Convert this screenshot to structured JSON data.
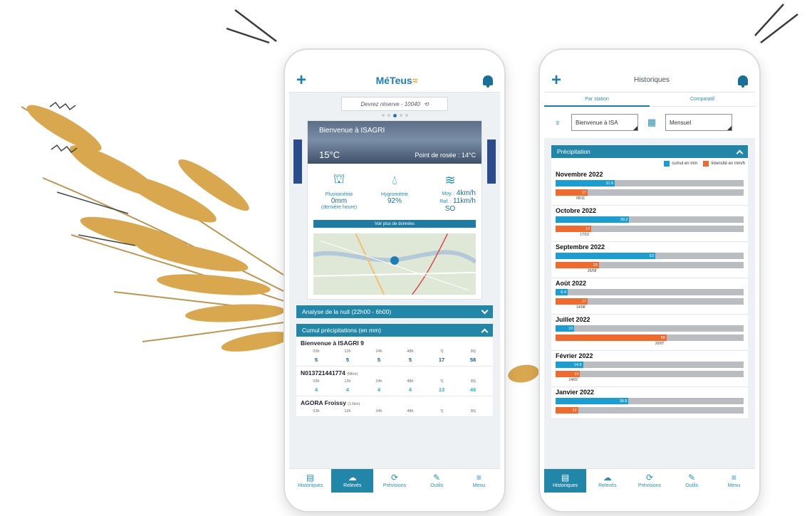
{
  "colors": {
    "primary": "#2286a8",
    "blue_series": "#1a9dd0",
    "orange_series": "#ef6a2c",
    "brand_accent": "#f5a623"
  },
  "phone1": {
    "logo": "MéTeus",
    "station_select": "Devrez réserve - 10040",
    "weather": {
      "station_title": "Bienvenue à ISAGRI",
      "temperature": "15°C",
      "dew_point": "Point de rosée : 14°C"
    },
    "metrics": {
      "rain_label": "Pluviométrie",
      "rain_value": "0mm",
      "rain_note": "(dernière heure)",
      "humidity_label": "Hygrométrie",
      "humidity_value": "92%",
      "wind_avg_label": "Moy. :",
      "wind_avg_value": "4km/h",
      "wind_gust_label": "Raf. :",
      "wind_gust_value": "11km/h",
      "wind_dir": "SO"
    },
    "more_data": "Voir plus de données",
    "night_analysis": "Analyse de la nuit (22h00 - 6h00)",
    "precip_title": "Cumul précipitations (en mm)",
    "precip_headers": [
      "03h",
      "12h",
      "24h",
      "48h",
      "7j",
      "30j"
    ],
    "stations": [
      {
        "name": "Bienvenue à ISAGRI 9",
        "tag": "",
        "values": [
          "5",
          "5",
          "5",
          "5",
          "17",
          "58"
        ]
      },
      {
        "name": "N013721441774",
        "tag": "(MKm)",
        "values": [
          "4",
          "4",
          "4",
          "4",
          "13",
          "46"
        ]
      },
      {
        "name": "AGORA Froissy",
        "tag": "(1.6km)",
        "values": [
          "",
          "",
          "",
          "",
          "",
          ""
        ]
      }
    ],
    "nav": [
      "Historiques",
      "Relevés",
      "Prévisions",
      "Outils",
      "Menu"
    ]
  },
  "phone2": {
    "title": "Historiques",
    "tabs": [
      "Par station",
      "Comparatif"
    ],
    "station_filter": "Bienvenue à ISA",
    "period_filter": "Mensuel",
    "section_title": "Précipitation",
    "legend_cumul": "cumul en mm",
    "legend_intensity": "Intensité en mm/h",
    "months": [
      {
        "name": "Novembre 2022",
        "cumul": 31.5,
        "cumul_label": "31.5",
        "intensity": 17,
        "intensity_label": "17",
        "date": "05/11"
      },
      {
        "name": "Octobre 2022",
        "cumul": 39.2,
        "cumul_label": "39.2",
        "intensity": 19,
        "intensity_label": "19",
        "date": "17/10"
      },
      {
        "name": "Septembre 2022",
        "cumul": 53,
        "cumul_label": "53",
        "intensity": 23,
        "intensity_label": "23",
        "date": "25/09"
      },
      {
        "name": "Août 2022",
        "cumul": 6.4,
        "cumul_label": "6.4",
        "intensity": 17,
        "intensity_label": "17",
        "date": "14/08"
      },
      {
        "name": "Juillet 2022",
        "cumul": 10,
        "cumul_label": "10",
        "intensity": 59,
        "intensity_label": "59",
        "date": "20/07"
      },
      {
        "name": "Février 2022",
        "cumul": 14.6,
        "cumul_label": "14.6",
        "intensity": 13,
        "intensity_label": "13",
        "date": "14/02"
      },
      {
        "name": "Janvier 2022",
        "cumul": 38.8,
        "cumul_label": "38.8",
        "intensity": 12,
        "intensity_label": "12",
        "date": ""
      }
    ],
    "bar_max": 100,
    "nav": [
      "Historiques",
      "Relevés",
      "Prévisions",
      "Outils",
      "Menu"
    ]
  }
}
